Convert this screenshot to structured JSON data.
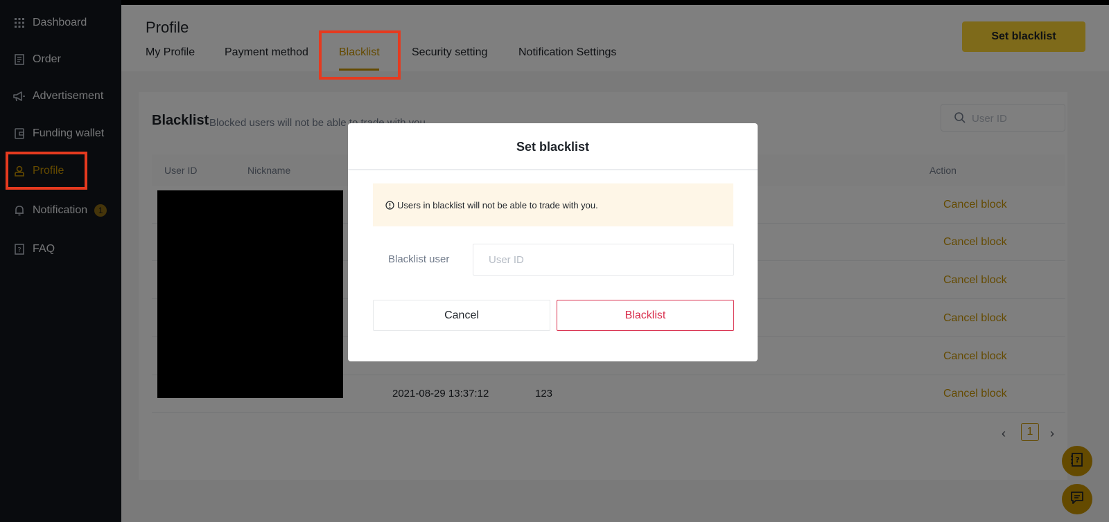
{
  "sidebar": {
    "items": [
      {
        "label": "Dashboard",
        "icon": "grid-icon"
      },
      {
        "label": "Order",
        "icon": "receipt-icon"
      },
      {
        "label": "Advertisement",
        "icon": "megaphone-icon"
      },
      {
        "label": "Funding wallet",
        "icon": "wallet-icon"
      },
      {
        "label": "Profile",
        "icon": "user-icon",
        "active": true
      },
      {
        "label": "Notification",
        "icon": "bell-icon",
        "badge": "1"
      },
      {
        "label": "FAQ",
        "icon": "faq-icon"
      }
    ]
  },
  "header": {
    "title": "Profile",
    "tabs": [
      {
        "label": "My Profile"
      },
      {
        "label": "Payment method"
      },
      {
        "label": "Blacklist",
        "active": true
      },
      {
        "label": "Security setting"
      },
      {
        "label": "Notification Settings"
      }
    ],
    "set_blacklist_label": "Set blacklist"
  },
  "blacklist": {
    "title": "Blacklist",
    "subtitle": "Blocked users will not be able to trade with you",
    "search_placeholder": "User ID",
    "columns": {
      "user_id": "User ID",
      "nickname": "Nickname",
      "action": "Action"
    },
    "rows": [
      {
        "time": "",
        "value": "",
        "action": "Cancel block"
      },
      {
        "time": "",
        "value": "",
        "action": "Cancel block"
      },
      {
        "time": "",
        "value": "",
        "action": "Cancel block"
      },
      {
        "time": "",
        "value": "",
        "action": "Cancel block"
      },
      {
        "time": "",
        "value": "",
        "action": "Cancel block"
      },
      {
        "time": "2021-08-29 13:37:12",
        "value": "123",
        "action": "Cancel block"
      }
    ],
    "pagination": {
      "current": "1",
      "prev": "‹",
      "next": "›"
    }
  },
  "modal": {
    "title": "Set blacklist",
    "notice": "Users in blacklist will not be able to trade with you.",
    "field_label": "Blacklist user",
    "field_placeholder": "User ID",
    "cancel_label": "Cancel",
    "confirm_label": "Blacklist"
  },
  "colors": {
    "accent": "#c99400",
    "brand_yellow": "#fcd535",
    "danger": "#d9304e",
    "highlight_box": "#e53a1f"
  }
}
